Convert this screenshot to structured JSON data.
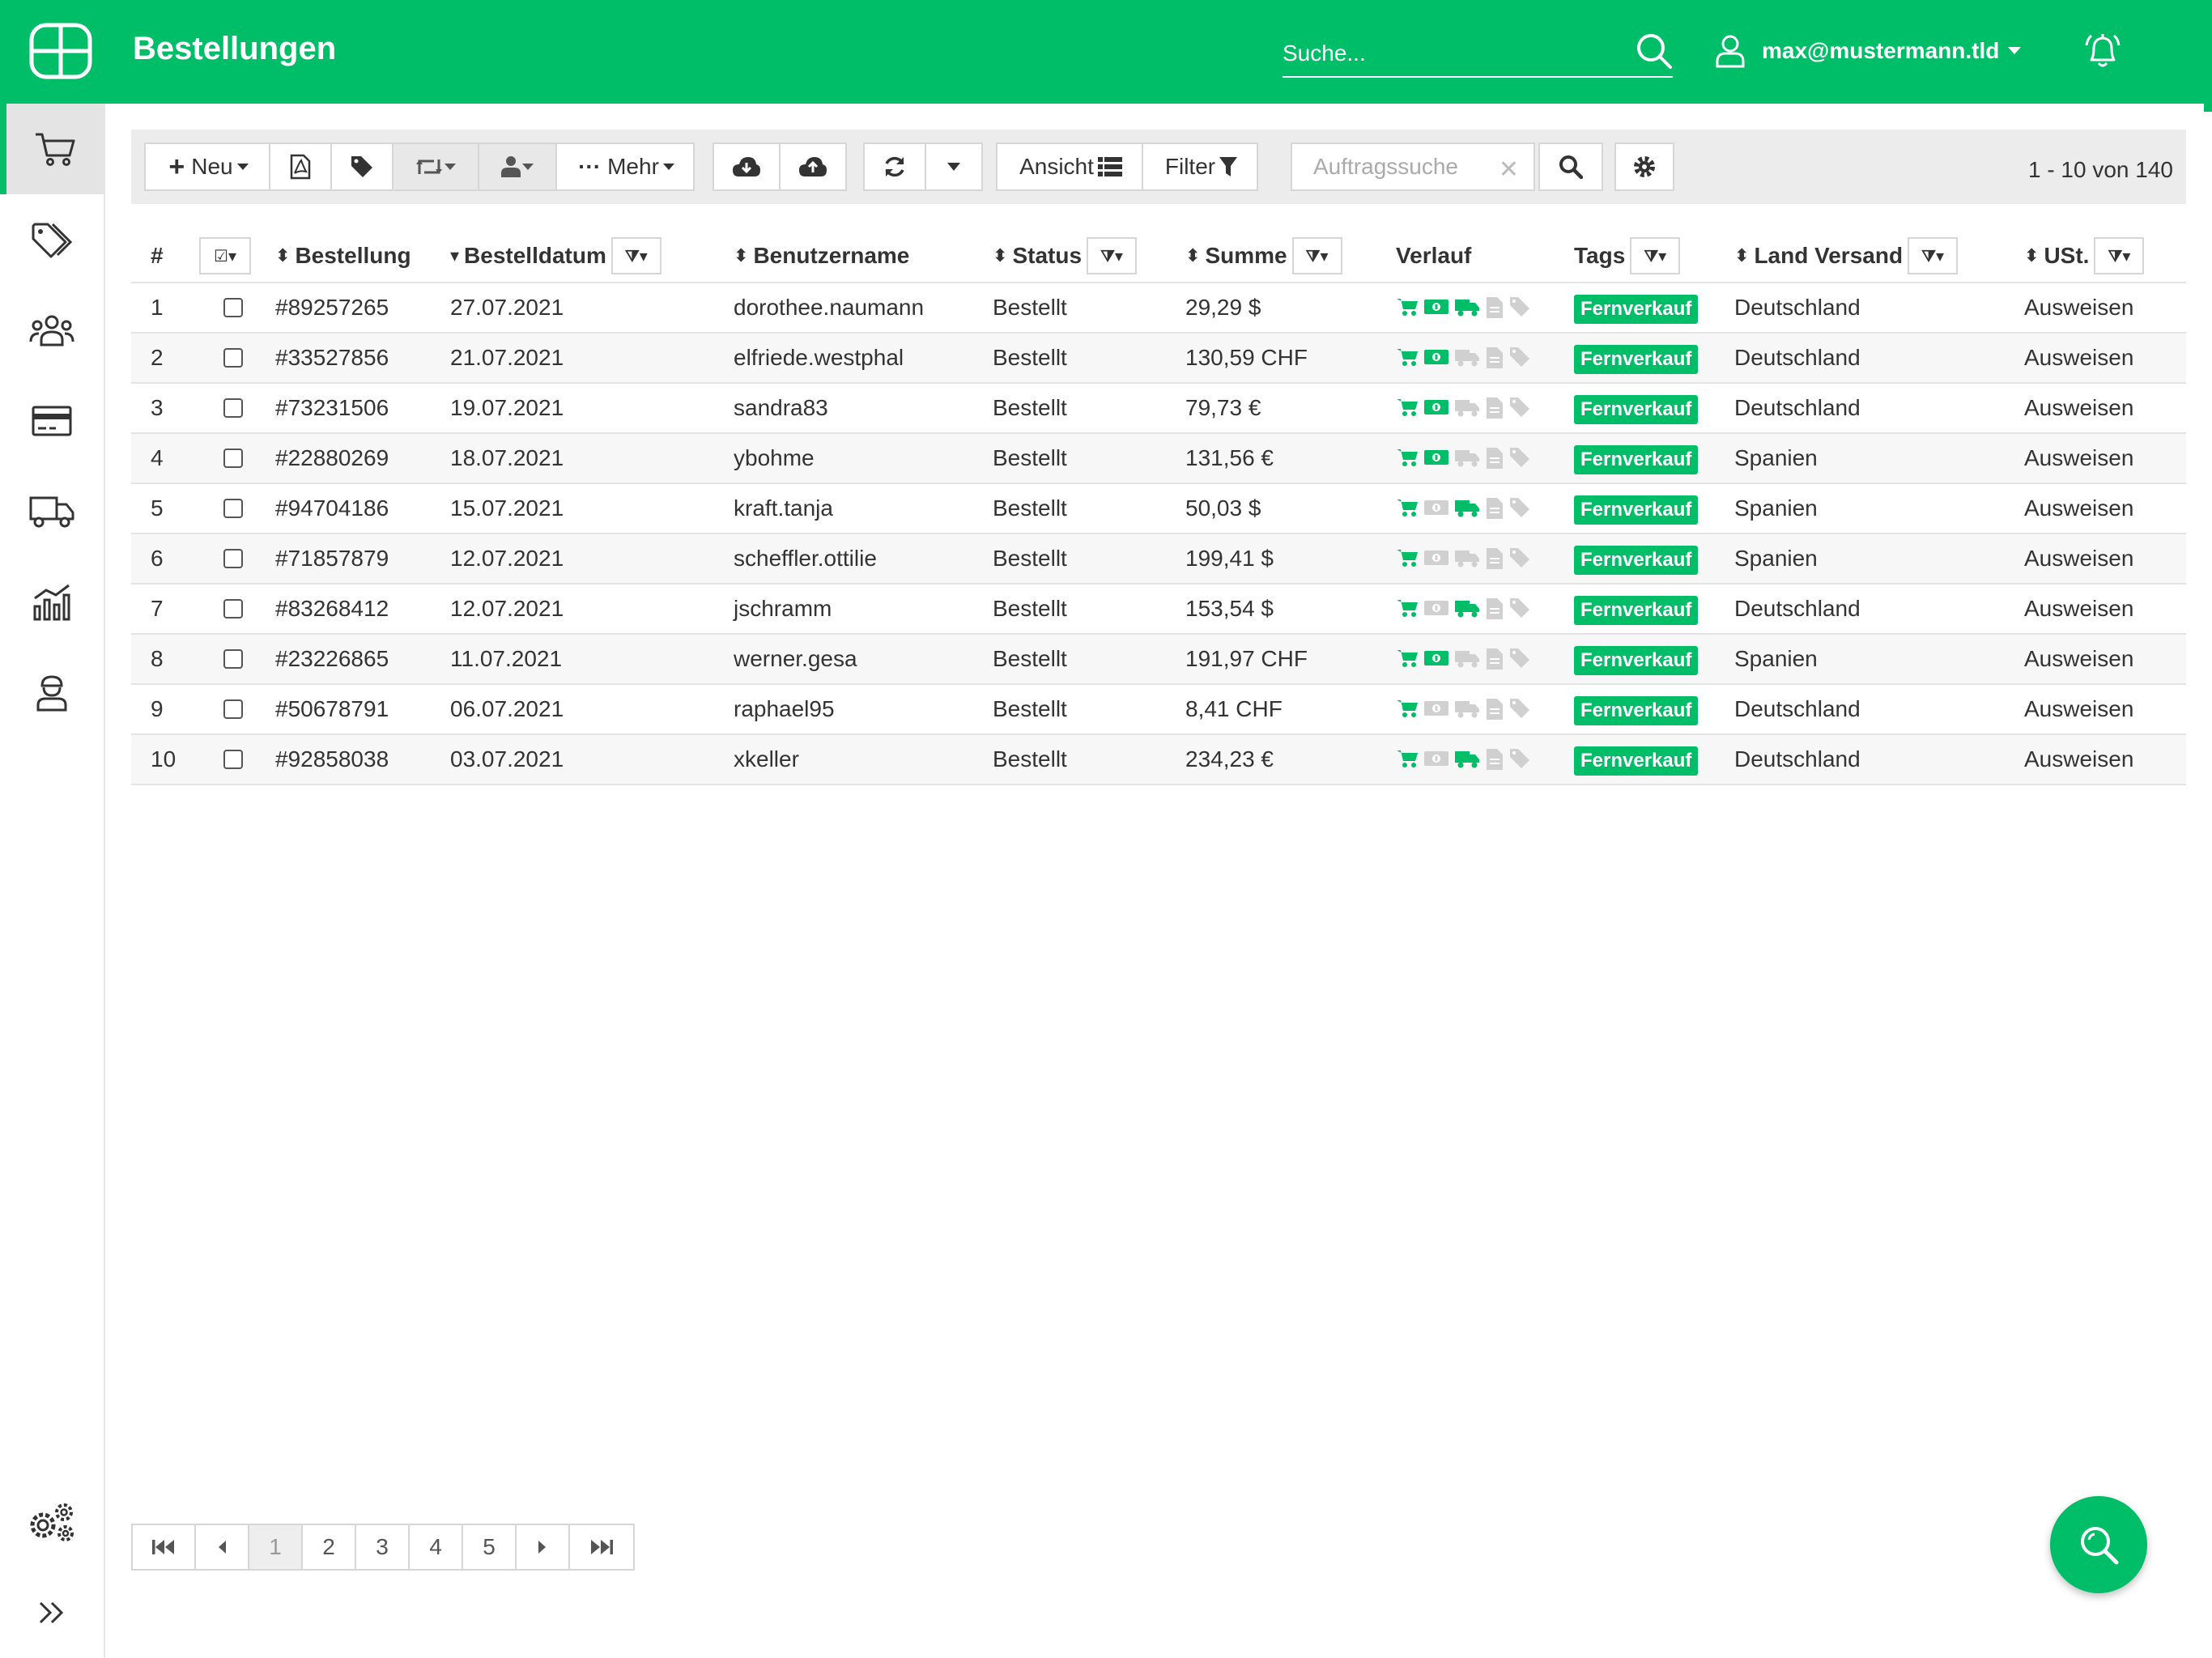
{
  "header": {
    "title": "Bestellungen",
    "search_placeholder": "Suche...",
    "user_email": "max@mustermann.tld"
  },
  "colors": {
    "brand": "#00bd67",
    "inactive_icon": "#d0d0d0"
  },
  "sidebar": {
    "items": [
      {
        "icon": "cart-icon",
        "active": true
      },
      {
        "icon": "tags-icon"
      },
      {
        "icon": "users-icon"
      },
      {
        "icon": "credit-card-icon"
      },
      {
        "icon": "truck-icon"
      },
      {
        "icon": "chart-icon"
      },
      {
        "icon": "worker-icon"
      },
      {
        "icon": "settings-gears-icon"
      },
      {
        "icon": "expand-icon"
      }
    ]
  },
  "toolbar": {
    "new_label": "Neu",
    "more_label": "Mehr",
    "view_label": "Ansicht",
    "filter_label": "Filter",
    "order_search_placeholder": "Auftragssuche",
    "paging_info": "1 - 10 von 140"
  },
  "table": {
    "columns": {
      "num": "#",
      "order": "Bestellung",
      "date": "Bestelldatum",
      "user": "Benutzername",
      "status": "Status",
      "sum": "Summe",
      "history": "Verlauf",
      "tags": "Tags",
      "country": "Land Versand",
      "vat": "USt."
    },
    "rows": [
      {
        "num": "1",
        "order": "#89257265",
        "date": "27.07.2021",
        "user": "dorothee.naumann",
        "status": "Bestellt",
        "sum": "29,29 $",
        "tag": "Fernverkauf",
        "country": "Deutschland",
        "vat": "Ausweisen",
        "paid": true,
        "shipped": true
      },
      {
        "num": "2",
        "order": "#33527856",
        "date": "21.07.2021",
        "user": "elfriede.westphal",
        "status": "Bestellt",
        "sum": "130,59 CHF",
        "tag": "Fernverkauf",
        "country": "Deutschland",
        "vat": "Ausweisen",
        "paid": true,
        "shipped": false
      },
      {
        "num": "3",
        "order": "#73231506",
        "date": "19.07.2021",
        "user": "sandra83",
        "status": "Bestellt",
        "sum": "79,73 €",
        "tag": "Fernverkauf",
        "country": "Deutschland",
        "vat": "Ausweisen",
        "paid": true,
        "shipped": false
      },
      {
        "num": "4",
        "order": "#22880269",
        "date": "18.07.2021",
        "user": "ybohme",
        "status": "Bestellt",
        "sum": "131,56 €",
        "tag": "Fernverkauf",
        "country": "Spanien",
        "vat": "Ausweisen",
        "paid": true,
        "shipped": false
      },
      {
        "num": "5",
        "order": "#94704186",
        "date": "15.07.2021",
        "user": "kraft.tanja",
        "status": "Bestellt",
        "sum": "50,03 $",
        "tag": "Fernverkauf",
        "country": "Spanien",
        "vat": "Ausweisen",
        "paid": false,
        "shipped": true
      },
      {
        "num": "6",
        "order": "#71857879",
        "date": "12.07.2021",
        "user": "scheffler.ottilie",
        "status": "Bestellt",
        "sum": "199,41 $",
        "tag": "Fernverkauf",
        "country": "Spanien",
        "vat": "Ausweisen",
        "paid": false,
        "shipped": false
      },
      {
        "num": "7",
        "order": "#83268412",
        "date": "12.07.2021",
        "user": "jschramm",
        "status": "Bestellt",
        "sum": "153,54 $",
        "tag": "Fernverkauf",
        "country": "Deutschland",
        "vat": "Ausweisen",
        "paid": false,
        "shipped": true
      },
      {
        "num": "8",
        "order": "#23226865",
        "date": "11.07.2021",
        "user": "werner.gesa",
        "status": "Bestellt",
        "sum": "191,97 CHF",
        "tag": "Fernverkauf",
        "country": "Spanien",
        "vat": "Ausweisen",
        "paid": true,
        "shipped": false
      },
      {
        "num": "9",
        "order": "#50678791",
        "date": "06.07.2021",
        "user": "raphael95",
        "status": "Bestellt",
        "sum": "8,41 CHF",
        "tag": "Fernverkauf",
        "country": "Deutschland",
        "vat": "Ausweisen",
        "paid": false,
        "shipped": false
      },
      {
        "num": "10",
        "order": "#92858038",
        "date": "03.07.2021",
        "user": "xkeller",
        "status": "Bestellt",
        "sum": "234,23 €",
        "tag": "Fernverkauf",
        "country": "Deutschland",
        "vat": "Ausweisen",
        "paid": false,
        "shipped": true
      }
    ]
  },
  "pagination": {
    "pages": [
      "1",
      "2",
      "3",
      "4",
      "5"
    ],
    "current": "1"
  }
}
